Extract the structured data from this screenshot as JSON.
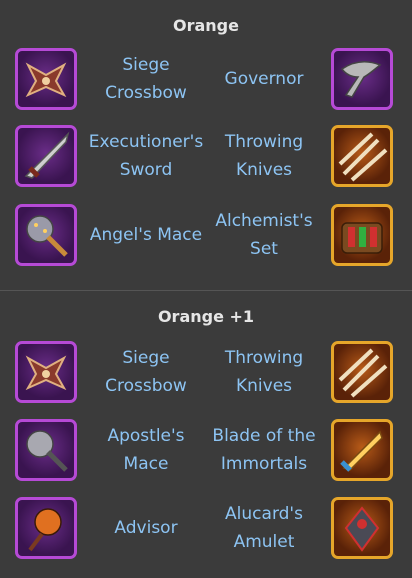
{
  "sections": [
    {
      "title": "Orange",
      "rows": [
        {
          "left_label": "Siege Crossbow",
          "right_label": "Governor",
          "left_icon": "siege-crossbow-icon",
          "right_icon": "governor-icon",
          "left_frame": "purple",
          "right_frame": "purple"
        },
        {
          "left_label": "Executioner's Sword",
          "right_label": "Throwing Knives",
          "left_icon": "executioners-sword-icon",
          "right_icon": "throwing-knives-icon",
          "left_frame": "purple",
          "right_frame": "orange"
        },
        {
          "left_label": "Angel's Mace",
          "right_label": "Alchemist's Set",
          "left_icon": "angels-mace-icon",
          "right_icon": "alchemists-set-icon",
          "left_frame": "purple",
          "right_frame": "orange"
        }
      ]
    },
    {
      "title": "Orange +1",
      "rows": [
        {
          "left_label": "Siege Crossbow",
          "right_label": "Throwing Knives",
          "left_icon": "siege-crossbow-icon",
          "right_icon": "throwing-knives-icon",
          "left_frame": "purple",
          "right_frame": "orange"
        },
        {
          "left_label": "Apostle's Mace",
          "right_label": "Blade of the Immortals",
          "left_icon": "apostles-mace-icon",
          "right_icon": "blade-of-the-immortals-icon",
          "left_frame": "purple",
          "right_frame": "orange"
        },
        {
          "left_label": "Advisor",
          "right_label": "Alucard's Amulet",
          "left_icon": "advisor-icon",
          "right_icon": "alucards-amulet-icon",
          "left_frame": "purple",
          "right_frame": "orange"
        }
      ]
    }
  ]
}
